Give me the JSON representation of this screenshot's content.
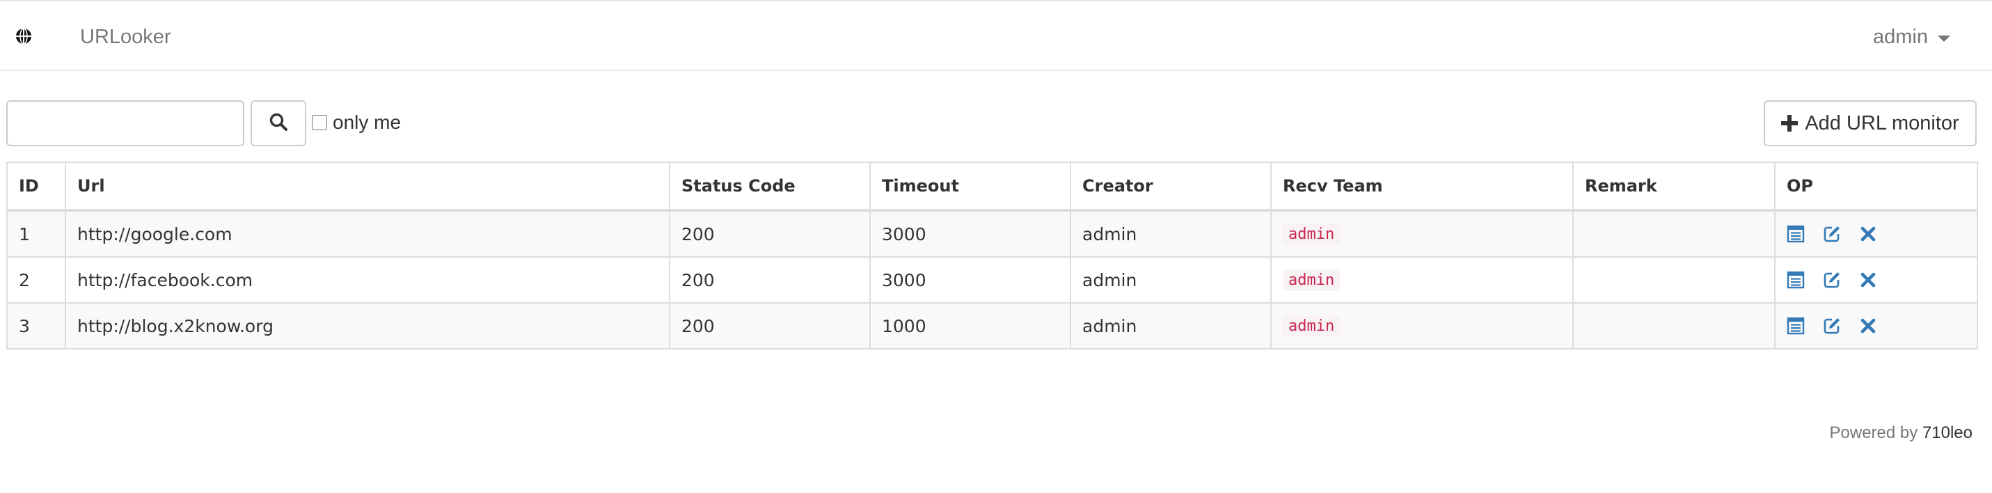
{
  "navbar": {
    "logo_icon": "globe-icon",
    "brand": "URLooker",
    "user": "admin"
  },
  "toolbar": {
    "search_value": "",
    "search_placeholder": "",
    "search_icon": "search-icon",
    "only_me_label": "only me",
    "only_me_checked": false,
    "add_label": "Add URL monitor",
    "add_icon": "plus-icon"
  },
  "table": {
    "headers": [
      "ID",
      "Url",
      "Status Code",
      "Timeout",
      "Creator",
      "Recv Team",
      "Remark",
      "OP"
    ],
    "rows": [
      {
        "id": "1",
        "url": "http://google.com",
        "status_code": "200",
        "timeout": "3000",
        "creator": "admin",
        "recv_team": "admin",
        "remark": ""
      },
      {
        "id": "2",
        "url": "http://facebook.com",
        "status_code": "200",
        "timeout": "3000",
        "creator": "admin",
        "recv_team": "admin",
        "remark": ""
      },
      {
        "id": "3",
        "url": "http://blog.x2know.org",
        "status_code": "200",
        "timeout": "1000",
        "creator": "admin",
        "recv_team": "admin",
        "remark": ""
      }
    ],
    "op_icons": [
      "list-icon",
      "edit-icon",
      "delete-icon"
    ]
  },
  "footer": {
    "prefix": "Powered by",
    "author": "710leo"
  },
  "colors": {
    "link_blue": "#337ab7",
    "badge_text": "#c7254e",
    "badge_bg": "#f9f2f4",
    "muted": "#777777",
    "border": "#dddddd"
  }
}
